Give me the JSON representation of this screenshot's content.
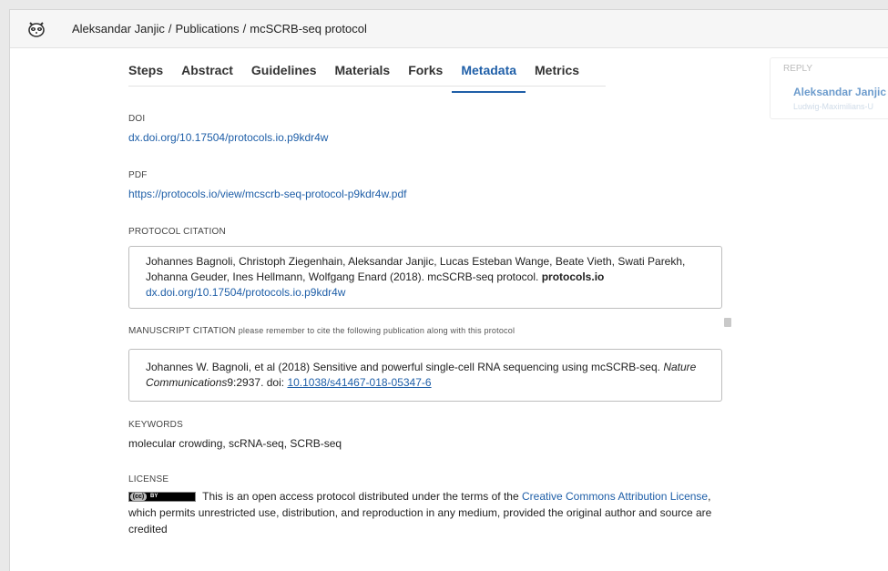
{
  "breadcrumb": {
    "author": "Aleksandar Janjic",
    "sep1": "/",
    "section": "Publications",
    "sep2": "/",
    "page": "mcSCRB-seq protocol"
  },
  "tabs": [
    {
      "label": "Steps"
    },
    {
      "label": "Abstract"
    },
    {
      "label": "Guidelines"
    },
    {
      "label": "Materials"
    },
    {
      "label": "Forks"
    },
    {
      "label": "Metadata",
      "active": true
    },
    {
      "label": "Metrics"
    }
  ],
  "sidebar": {
    "reply_label": "REPLY",
    "name": "Aleksandar Janjic",
    "affiliation": "Ludwig-Maximilians-U"
  },
  "doi": {
    "label": "DOI",
    "value": "dx.doi.org/10.17504/protocols.io.p9kdr4w"
  },
  "pdf": {
    "label": "PDF",
    "value": "https://protocols.io/view/mcscrb-seq-protocol-p9kdr4w.pdf"
  },
  "protocol_citation": {
    "label": "PROTOCOL CITATION",
    "text": "Johannes Bagnoli, Christoph Ziegenhain, Aleksandar Janjic, Lucas Esteban Wange, Beate Vieth, Swati Parekh, Johanna Geuder, Ines Hellmann, Wolfgang Enard (2018). mcSCRB-seq protocol.",
    "journal": "protocols.io",
    "doi": "dx.doi.org/10.17504/protocols.io.p9kdr4w"
  },
  "manuscript_citation": {
    "label": "MANUSCRIPT CITATION",
    "note": "please remember to cite the following publication along with this protocol",
    "text_before": "Johannes W. Bagnoli, et al (2018) Sensitive and powerful single-cell RNA sequencing using mcSCRB-seq.",
    "journal": "Nature Communications",
    "text_after": "9:2937. doi:",
    "doi_link": "10.1038/s41467-018-05347-6"
  },
  "keywords": {
    "label": "KEYWORDS",
    "value": "molecular crowding, scRNA-seq, SCRB-seq"
  },
  "license": {
    "label": "LICENSE",
    "badge_cc": "(cc)",
    "badge_by": "BY",
    "text_before": "This is an open access protocol distributed under the terms of the",
    "link": "Creative Commons Attribution License",
    "text_after": ", which permits unrestricted use, distribution, and reproduction in any medium, provided the original author and source are credited"
  },
  "colors": {
    "accent": "#1f5fa8",
    "sidebar_name": "#6d9ccd"
  },
  "icons": {
    "logo": "raccoon-logo-icon",
    "pdf": "pdf-file-icon"
  }
}
